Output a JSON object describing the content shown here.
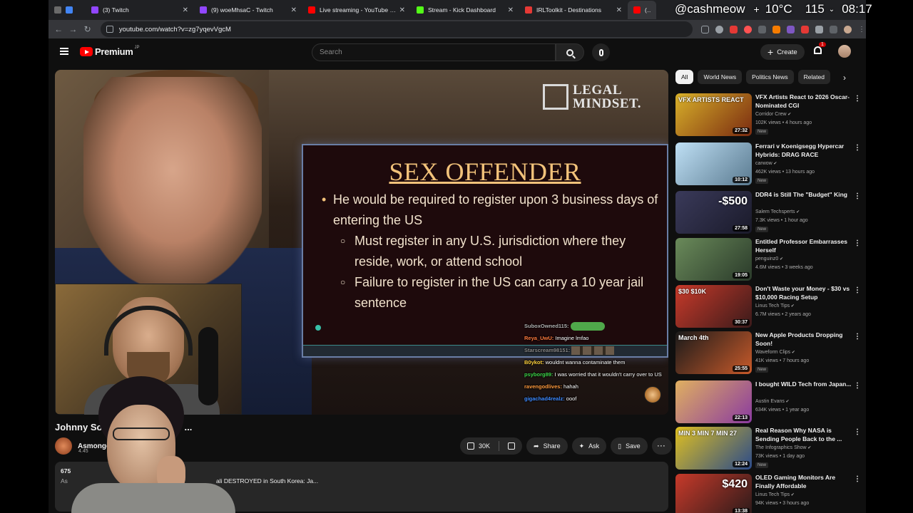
{
  "browser": {
    "tabs": [
      {
        "title": "",
        "color": "#4285f4"
      },
      {
        "title": "(3) Twitch",
        "color": "#9146ff"
      },
      {
        "title": "(9) woeMhsaC - Twitch",
        "color": "#9146ff"
      },
      {
        "title": "Live streaming - YouTube Stu",
        "color": "#ff0000"
      },
      {
        "title": "Stream - Kick Dashboard",
        "color": "#53fc18"
      },
      {
        "title": "IRLToolkit - Destinations",
        "color": "#e53935"
      },
      {
        "title": "(1) Jo",
        "color": "#ff0000"
      }
    ],
    "url": "youtube.com/watch?v=zg7yqevVgcM"
  },
  "stream_overlay": {
    "handle": "@cashmeow",
    "temperature": "10°C",
    "count": "115",
    "time": "08:17"
  },
  "header": {
    "logo_text": "Premium",
    "logo_sup": "JP",
    "search_placeholder": "Search",
    "create_label": "Create",
    "notif_count": "1"
  },
  "player": {
    "watermark_line1": "LEGAL",
    "watermark_line2": "MINDSET.",
    "slide_title": "SEX OFFENDER",
    "bullet_main": "He would be required to register upon 3 business days of entering the US",
    "sub_bullets": [
      "Must register in any U.S. jurisdiction where they reside, work, or attend school",
      "Failure to register in the US can carry a 10 year jail sentence"
    ],
    "chat": [
      {
        "user": "SuboxOwned115:",
        "text": "",
        "color": "#b0b0b0",
        "emote": "pepe"
      },
      {
        "user": "Reya_UwU:",
        "text": "Imagine lmfao",
        "color": "#ff7a3d"
      },
      {
        "user": "Starscream98151:",
        "text": "",
        "color": "#8a8a8a",
        "emote": "row"
      },
      {
        "user": "B0ykot:",
        "text": "wouldnt wanna contaminate them",
        "color": "#ffd23d"
      },
      {
        "user": "psyborg89:",
        "text": "I was worried that it wouldn't carry over to US",
        "color": "#3dd64a"
      },
      {
        "user": "ravengodlives:",
        "text": "hahah",
        "color": "#ff9a3d"
      },
      {
        "user": "gigachad4realz:",
        "text": "ooof",
        "color": "#3d8aff"
      }
    ]
  },
  "video": {
    "title": "Johnny Sor",
    "title_tail": "...",
    "channel": "Asmongo",
    "subs": "4.45",
    "likes": "30K",
    "share": "Share",
    "ask": "Ask",
    "save": "Save",
    "desc_views": "675",
    "desc_prefix": "As",
    "desc_snippet": "ali DESTROYED in South Korea: Ja..."
  },
  "sidebar": {
    "chips": [
      "All",
      "World News",
      "Politics News",
      "Related"
    ],
    "recs": [
      {
        "title": "VFX Artists React to 2026 Oscar-Nominated CGI",
        "channel": "Corridor Crew",
        "meta": "102K views • 4 hours ago",
        "badge": "New",
        "duration": "27:32",
        "thumb_label": "VFX ARTISTS REACT",
        "thumb_big": "",
        "c1": "#d8b12a",
        "c2": "#7a2a10"
      },
      {
        "title": "Ferrari v Koenigsegg Hypercar Hybrids: DRAG RACE",
        "channel": "carwow",
        "meta": "462K views • 13 hours ago",
        "badge": "New",
        "duration": "10:12",
        "thumb_label": "",
        "thumb_big": "",
        "c1": "#bfe0f5",
        "c2": "#5a7a90"
      },
      {
        "title": "DDR4 is Still The \"Budget\" King",
        "channel": "Salem Techsperts",
        "meta": "7.3K views • 1 hour ago",
        "badge": "New",
        "duration": "27:58",
        "thumb_label": "",
        "thumb_big": "-$500",
        "c1": "#3a3a5a",
        "c2": "#1a1a2a"
      },
      {
        "title": "Entitled Professor Embarrasses Herself",
        "channel": "penguinz0",
        "meta": "4.6M views • 3 weeks ago",
        "badge": "",
        "duration": "19:05",
        "thumb_label": "",
        "thumb_big": "",
        "c1": "#6a8a5a",
        "c2": "#2a3a2a"
      },
      {
        "title": "Don't Waste your Money - $30 vs $10,000 Racing Setup",
        "channel": "Linus Tech Tips",
        "meta": "6.7M views • 2 years ago",
        "badge": "",
        "duration": "30:37",
        "thumb_label": "$30  $10K",
        "thumb_big": "",
        "c1": "#c83a2a",
        "c2": "#3a1a1a"
      },
      {
        "title": "New Apple Products Dropping Soon!",
        "channel": "Waveform Clips",
        "meta": "41K views • 7 hours ago",
        "badge": "New",
        "duration": "25:55",
        "thumb_label": "March 4th",
        "thumb_big": "",
        "c1": "#1a1a1a",
        "c2": "#c85a2a"
      },
      {
        "title": "I bought WILD Tech from Japan...",
        "channel": "Austin Evans",
        "meta": "634K views • 1 year ago",
        "badge": "",
        "duration": "22:13",
        "thumb_label": "",
        "thumb_big": "",
        "c1": "#e0b060",
        "c2": "#8a3aa0"
      },
      {
        "title": "Real Reason Why NASA is Sending People Back to the ...",
        "channel": "The Infographics Show",
        "meta": "73K views • 1 day ago",
        "badge": "New",
        "duration": "12:24",
        "thumb_label": "MIN 3  MIN 7  MIN 27",
        "thumb_big": "",
        "c1": "#e0c020",
        "c2": "#2a4a8a"
      },
      {
        "title": "OLED Gaming Monitors Are Finally Affordable",
        "channel": "Linus Tech Tips",
        "meta": "94K views • 3 hours ago",
        "badge": "",
        "duration": "13:38",
        "thumb_label": "",
        "thumb_big": "$420",
        "c1": "#c83a2a",
        "c2": "#2a1a1a"
      }
    ]
  }
}
